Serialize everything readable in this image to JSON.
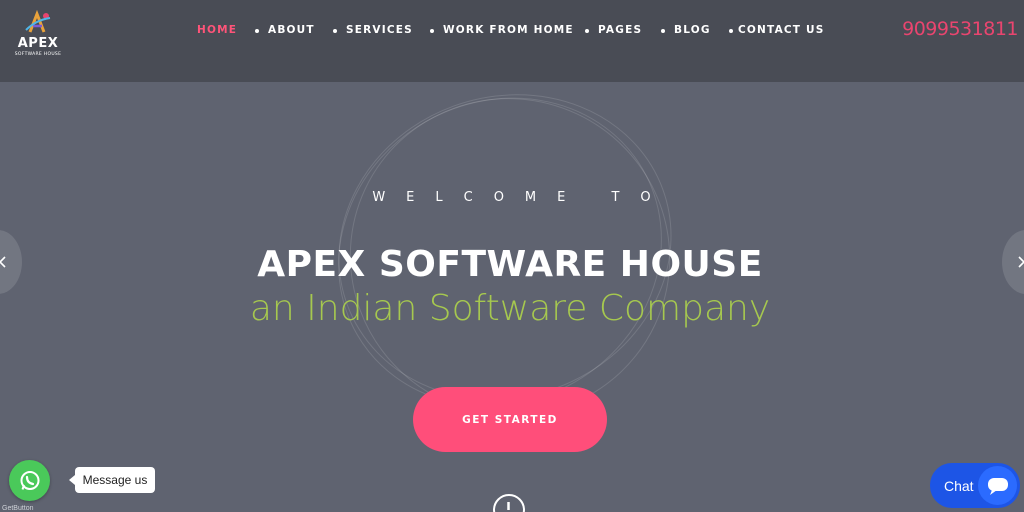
{
  "header": {
    "logo_text": "APEX",
    "logo_subtext": "SOFTWARE HOUSE",
    "phone": "9099531811",
    "nav": [
      {
        "label": "HOME",
        "active": true
      },
      {
        "label": "ABOUT",
        "active": false
      },
      {
        "label": "SERVICES",
        "active": false
      },
      {
        "label": "WORK FROM HOME",
        "active": false
      },
      {
        "label": "PAGES",
        "active": false
      },
      {
        "label": "BLOG",
        "active": false
      },
      {
        "label": "CONTACT US",
        "active": false
      }
    ]
  },
  "hero": {
    "welcome": "WELCOME TO",
    "title": "APEX SOFTWARE HOUSE",
    "subtitle": "an Indian Software Company",
    "cta_label": "GET STARTED"
  },
  "widgets": {
    "whatsapp_label": "Message us",
    "getbutton_label": "GetButton",
    "chat_label": "Chat"
  },
  "colors": {
    "header_bg": "#494c55",
    "hero_bg": "#5f6370",
    "accent_pink": "#ff4e7a",
    "subtitle_green": "#a6c84f",
    "whatsapp_green": "#4ac95a",
    "chat_blue": "#1d55e6"
  },
  "icons": {
    "logo": "apex-logo-icon",
    "prev": "chevron-left-icon",
    "next": "chevron-right-icon",
    "scroll": "scroll-down-icon",
    "whatsapp": "whatsapp-icon",
    "chat": "chat-bubble-icon"
  }
}
